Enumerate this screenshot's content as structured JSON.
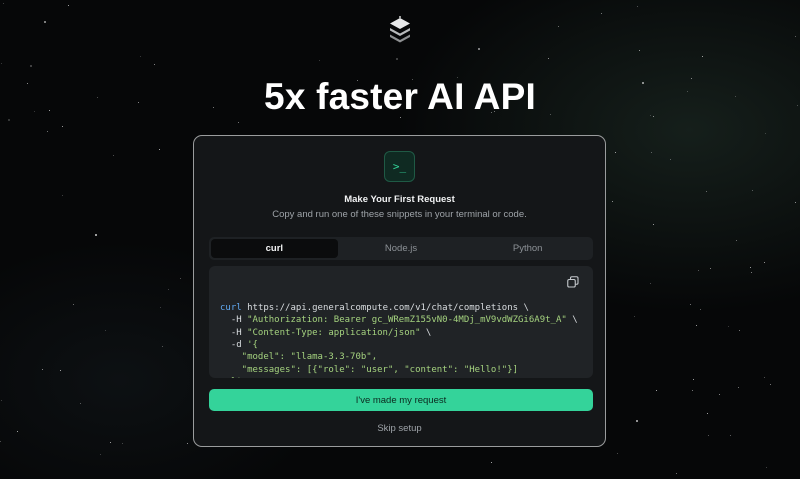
{
  "headline": "5x faster AI API",
  "logo": {
    "icon": "stacked-layers-logo-icon"
  },
  "card": {
    "icon": "terminal-icon",
    "icon_glyph": ">_",
    "title": "Make Your First Request",
    "subtitle": "Copy and run one of these snippets in your terminal or code.",
    "tabs": [
      {
        "label": "curl",
        "active": true
      },
      {
        "label": "Node.js",
        "active": false
      },
      {
        "label": "Python",
        "active": false
      }
    ],
    "code": {
      "lines": [
        [
          {
            "t": "curl",
            "c": "kw"
          },
          {
            "t": " https://api.generalcompute.com/v1/chat/completions \\",
            "c": ""
          }
        ],
        [
          {
            "t": "  -H ",
            "c": ""
          },
          {
            "t": "\"Authorization: Bearer gc_WRemZ155vN0-4MDj_mV9vdWZGi6A9t_A\"",
            "c": "str"
          },
          {
            "t": " \\",
            "c": ""
          }
        ],
        [
          {
            "t": "  -H ",
            "c": ""
          },
          {
            "t": "\"Content-Type: application/json\"",
            "c": "str"
          },
          {
            "t": " \\",
            "c": ""
          }
        ],
        [
          {
            "t": "  -d ",
            "c": ""
          },
          {
            "t": "'{",
            "c": "str"
          }
        ],
        [
          {
            "t": "    \"model\": \"llama-3.3-70b\",",
            "c": "str"
          }
        ],
        [
          {
            "t": "    \"messages\": [{\"role\": \"user\", \"content\": \"Hello!\"}]",
            "c": "str"
          }
        ],
        [
          {
            "t": "  }'",
            "c": "str"
          }
        ]
      ],
      "copy_icon": "copy-icon"
    },
    "primary_button": "I've made my request",
    "skip_link": "Skip setup"
  },
  "colors": {
    "accent": "#34d39a",
    "background": "#060708",
    "card": "#141618",
    "code_keyword": "#61a9f2",
    "code_string": "#a5d37f"
  }
}
